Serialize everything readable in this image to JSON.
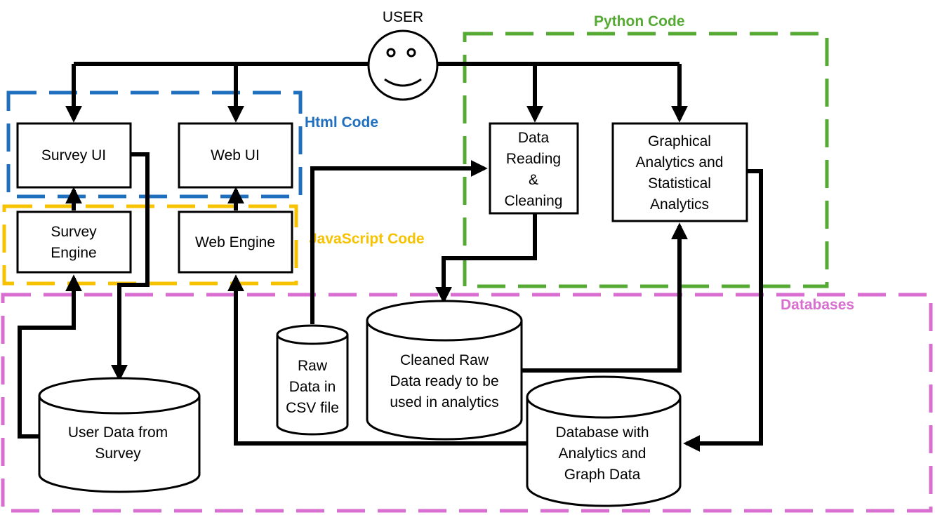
{
  "user": {
    "label": "USER"
  },
  "regions": {
    "html": {
      "label": "Html Code",
      "color": "#1f6fbf"
    },
    "javascript": {
      "label": "JavaScript Code",
      "color": "#f7c200"
    },
    "python": {
      "label": "Python Code",
      "color": "#55aa33"
    },
    "databases": {
      "label": "Databases",
      "color": "#d86fd0"
    }
  },
  "nodes": {
    "survey_ui": {
      "lines": [
        "Survey UI"
      ]
    },
    "web_ui": {
      "lines": [
        "Web UI"
      ]
    },
    "survey_engine": {
      "lines": [
        "Survey",
        "Engine"
      ]
    },
    "web_engine": {
      "lines": [
        "Web Engine"
      ]
    },
    "data_reading": {
      "lines": [
        "Data",
        "Reading",
        "&",
        "Cleaning"
      ]
    },
    "graphical_analytics": {
      "lines": [
        "Graphical",
        "Analytics and",
        "Statistical",
        "Analytics"
      ]
    },
    "raw_data": {
      "lines": [
        "Raw",
        "Data in",
        "CSV file"
      ]
    },
    "cleaned_raw_data": {
      "lines": [
        "Cleaned Raw",
        "Data ready to be",
        "used in analytics"
      ]
    },
    "user_data": {
      "lines": [
        "User Data from",
        "Survey"
      ]
    },
    "analytics_db": {
      "lines": [
        "Database with",
        "Analytics and",
        "Graph Data"
      ]
    }
  },
  "edges": [
    {
      "from": "user",
      "to": "survey_ui"
    },
    {
      "from": "user",
      "to": "web_ui"
    },
    {
      "from": "user",
      "to": "data_reading"
    },
    {
      "from": "user",
      "to": "graphical_analytics"
    },
    {
      "from": "survey_engine",
      "to": "survey_ui"
    },
    {
      "from": "web_engine",
      "to": "web_ui"
    },
    {
      "from": "survey_ui",
      "to": "user_data"
    },
    {
      "from": "user_data",
      "to": "survey_engine"
    },
    {
      "from": "raw_data",
      "to": "data_reading"
    },
    {
      "from": "data_reading",
      "to": "cleaned_raw_data"
    },
    {
      "from": "cleaned_raw_data",
      "to": "graphical_analytics"
    },
    {
      "from": "graphical_analytics",
      "to": "analytics_db"
    },
    {
      "from": "analytics_db",
      "to": "web_engine"
    }
  ]
}
